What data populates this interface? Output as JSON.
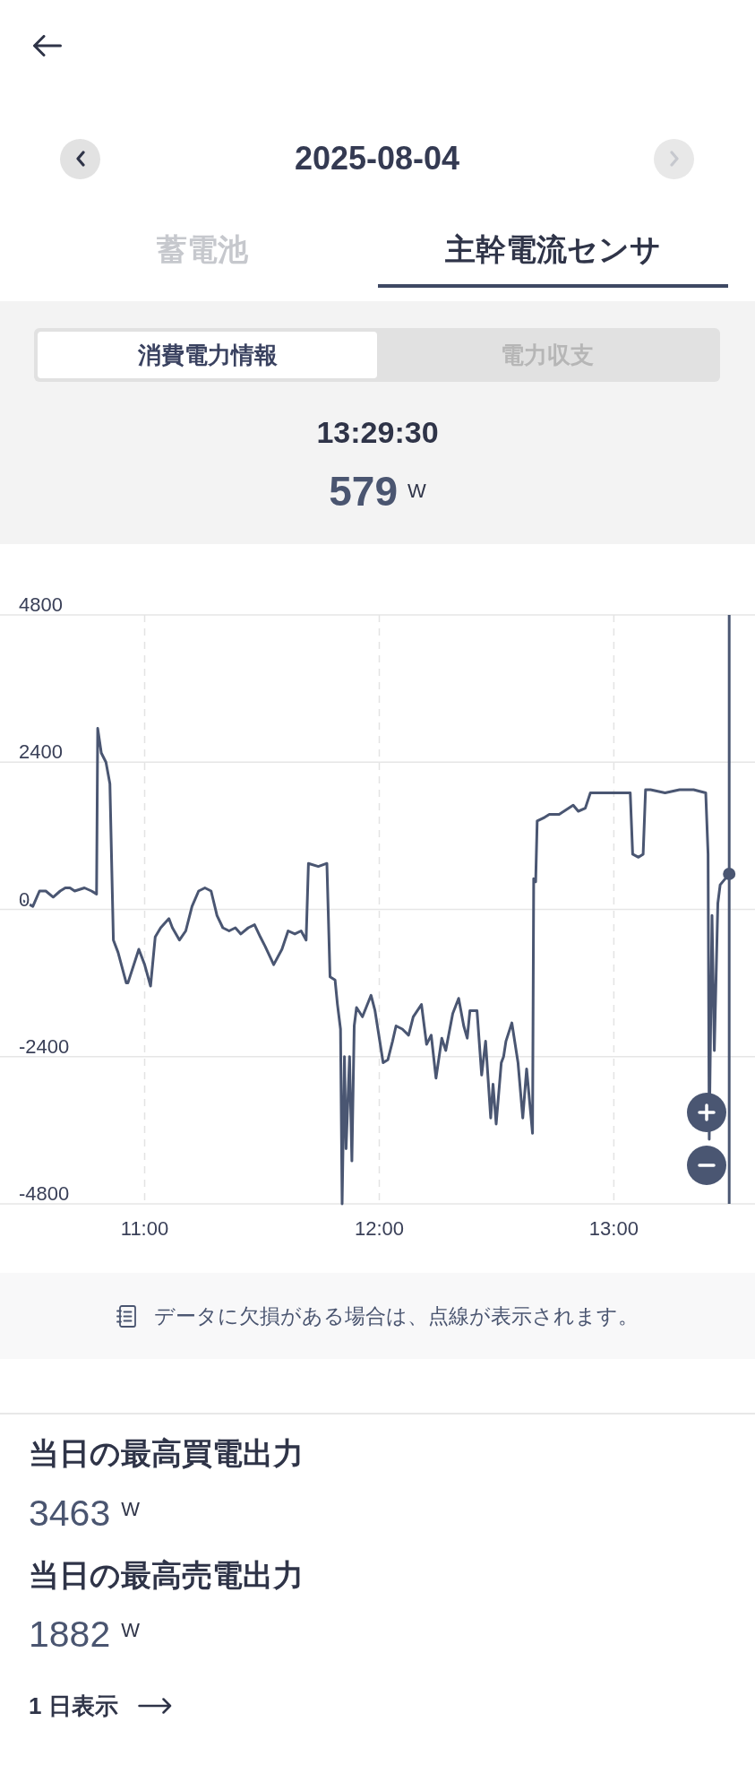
{
  "date_nav": {
    "date": "2025-08-04",
    "prev": {
      "disabled": false
    },
    "next": {
      "disabled": true
    }
  },
  "tabs": [
    {
      "label": "蓄電池",
      "selected": false
    },
    {
      "label": "主幹電流センサ",
      "selected": true
    }
  ],
  "segments": [
    {
      "label": "消費電力情報",
      "selected": true
    },
    {
      "label": "電力収支",
      "selected": false
    }
  ],
  "reading": {
    "time": "13:29:30",
    "value": "579",
    "unit": "W"
  },
  "chart": {
    "chart_data": {
      "type": "line",
      "grid": true,
      "xlim": [
        623,
        816.1
      ],
      "ylim": [
        -4800,
        4800
      ],
      "xticks": [
        {
          "value": 660,
          "label": "11:00"
        },
        {
          "value": 720,
          "label": "12:00"
        },
        {
          "value": 780,
          "label": "13:00"
        }
      ],
      "yticks": [
        4800,
        2400,
        0,
        -2400,
        -4800
      ],
      "ref_lines": [
        {
          "axis": "x",
          "value": 809.5
        }
      ],
      "x": [
        628.6,
        631.4,
        633.1,
        634.7,
        636.6,
        638.4,
        639.7,
        640.9,
        642.1,
        644.6,
        646.4,
        647.7,
        648.0,
        648.9,
        650.1,
        651.1,
        652.0,
        653.2,
        655.3,
        655.7,
        658.5,
        660.0,
        661.5,
        662.7,
        664.1,
        666.2,
        667.1,
        668.9,
        670.5,
        672.1,
        673.8,
        675.4,
        677.0,
        678.5,
        680.0,
        681.6,
        683.2,
        684.6,
        686.5,
        688.1,
        689.6,
        690.8,
        693.0,
        695.1,
        696.7,
        698.4,
        700.0,
        701.3,
        701.9,
        704.4,
        706.6,
        707.4,
        708.7,
        709.3,
        710.1,
        710.5,
        711.1,
        711.5,
        712.4,
        713.0,
        713.6,
        714.2,
        715.7,
        717.9,
        718.9,
        721.0,
        722.2,
        723.4,
        724.3,
        725.9,
        727.5,
        728.7,
        730.8,
        732.1,
        733.3,
        734.5,
        736.0,
        737.0,
        738.8,
        740.3,
        741.6,
        742.5,
        743.2,
        745.0,
        746.2,
        747.2,
        748.5,
        749.1,
        749.9,
        751.2,
        751.8,
        752.4,
        753.9,
        755.5,
        756.7,
        757.7,
        759.2,
        759.5,
        760.0,
        760.4,
        762.3,
        763.5,
        766.0,
        769.6,
        770.9,
        772.7,
        774.0,
        777.0,
        780.7,
        784.2,
        784.8,
        786.3,
        787.5,
        788.1,
        789.4,
        793.1,
        796.8,
        800.4,
        803.5,
        804.1,
        804.4,
        805.1,
        805.7,
        806.6,
        807.2,
        809.5
      ],
      "values": [
        150,
        50,
        300,
        300,
        200,
        300,
        350,
        350,
        300,
        350,
        300,
        250,
        2950,
        2550,
        2400,
        2050,
        -500,
        -700,
        -1200,
        -1200,
        -650,
        -900,
        -1250,
        -450,
        -300,
        -150,
        -300,
        -500,
        -350,
        50,
        300,
        350,
        300,
        -100,
        -300,
        -350,
        -300,
        -400,
        -300,
        -250,
        -450,
        -600,
        -900,
        -650,
        -350,
        -400,
        -350,
        -500,
        750,
        700,
        750,
        -1100,
        -1150,
        -1550,
        -1950,
        -4800,
        -2400,
        -3900,
        -2400,
        -4100,
        -1900,
        -1600,
        -1750,
        -1400,
        -1650,
        -2500,
        -2450,
        -2150,
        -1900,
        -1950,
        -2050,
        -1750,
        -1550,
        -2200,
        -2050,
        -2750,
        -2100,
        -2300,
        -1700,
        -1450,
        -1900,
        -2100,
        -1650,
        -1650,
        -2700,
        -2150,
        -3400,
        -2850,
        -3500,
        -2500,
        -2400,
        -2150,
        -1850,
        -2500,
        -3400,
        -2600,
        -3650,
        500,
        450,
        1440,
        1500,
        1550,
        1550,
        1700,
        1600,
        1650,
        1900,
        1900,
        1900,
        1900,
        900,
        850,
        900,
        1950,
        1950,
        1900,
        1950,
        1950,
        1900,
        900,
        -3750,
        -100,
        -2300,
        100,
        400,
        579
      ]
    }
  },
  "note": {
    "text": "データに欠損がある場合は、点線が表示されます。"
  },
  "stats": [
    {
      "label": "当日の最高買電出力",
      "value": "3463",
      "unit": "W"
    },
    {
      "label": "当日の最高売電出力",
      "value": "1882",
      "unit": "W"
    }
  ],
  "link": {
    "label": "1 日表示"
  }
}
